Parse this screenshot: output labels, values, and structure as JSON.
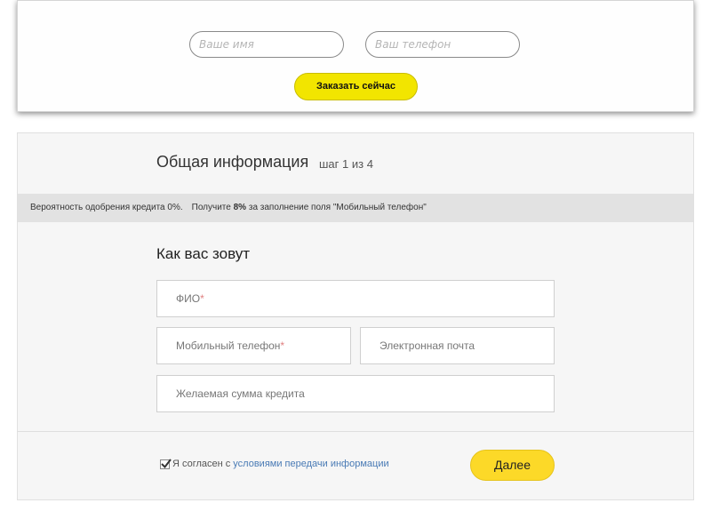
{
  "order_form": {
    "name_placeholder": "Ваше имя",
    "phone_placeholder": "Ваш телефон",
    "order_button": "Заказать сейчас"
  },
  "form": {
    "title": "Общая информация",
    "step": "шаг 1 из 4",
    "info_part1": "Вероятность одобрения кредита 0%.",
    "info_part2": "Получите",
    "info_bonus": "8%",
    "info_part3": "за заполнение поля \"Мобильный телефон\"",
    "section_title": "Как вас зовут",
    "fio_label": "ФИО",
    "mobile_label": "Мобильный телефон",
    "email_label": "Электронная почта",
    "amount_label": "Желаемая сумма кредита",
    "required_mark": "*",
    "agree_text": "Я согласен с",
    "agree_link": "условиями передачи информации",
    "agree_checked": true,
    "next_button": "Далее"
  },
  "colors": {
    "order_button": "#f2e500",
    "next_button": "#fcd928",
    "link": "#4a7bb5",
    "info_bar": "#e2e2e2"
  }
}
